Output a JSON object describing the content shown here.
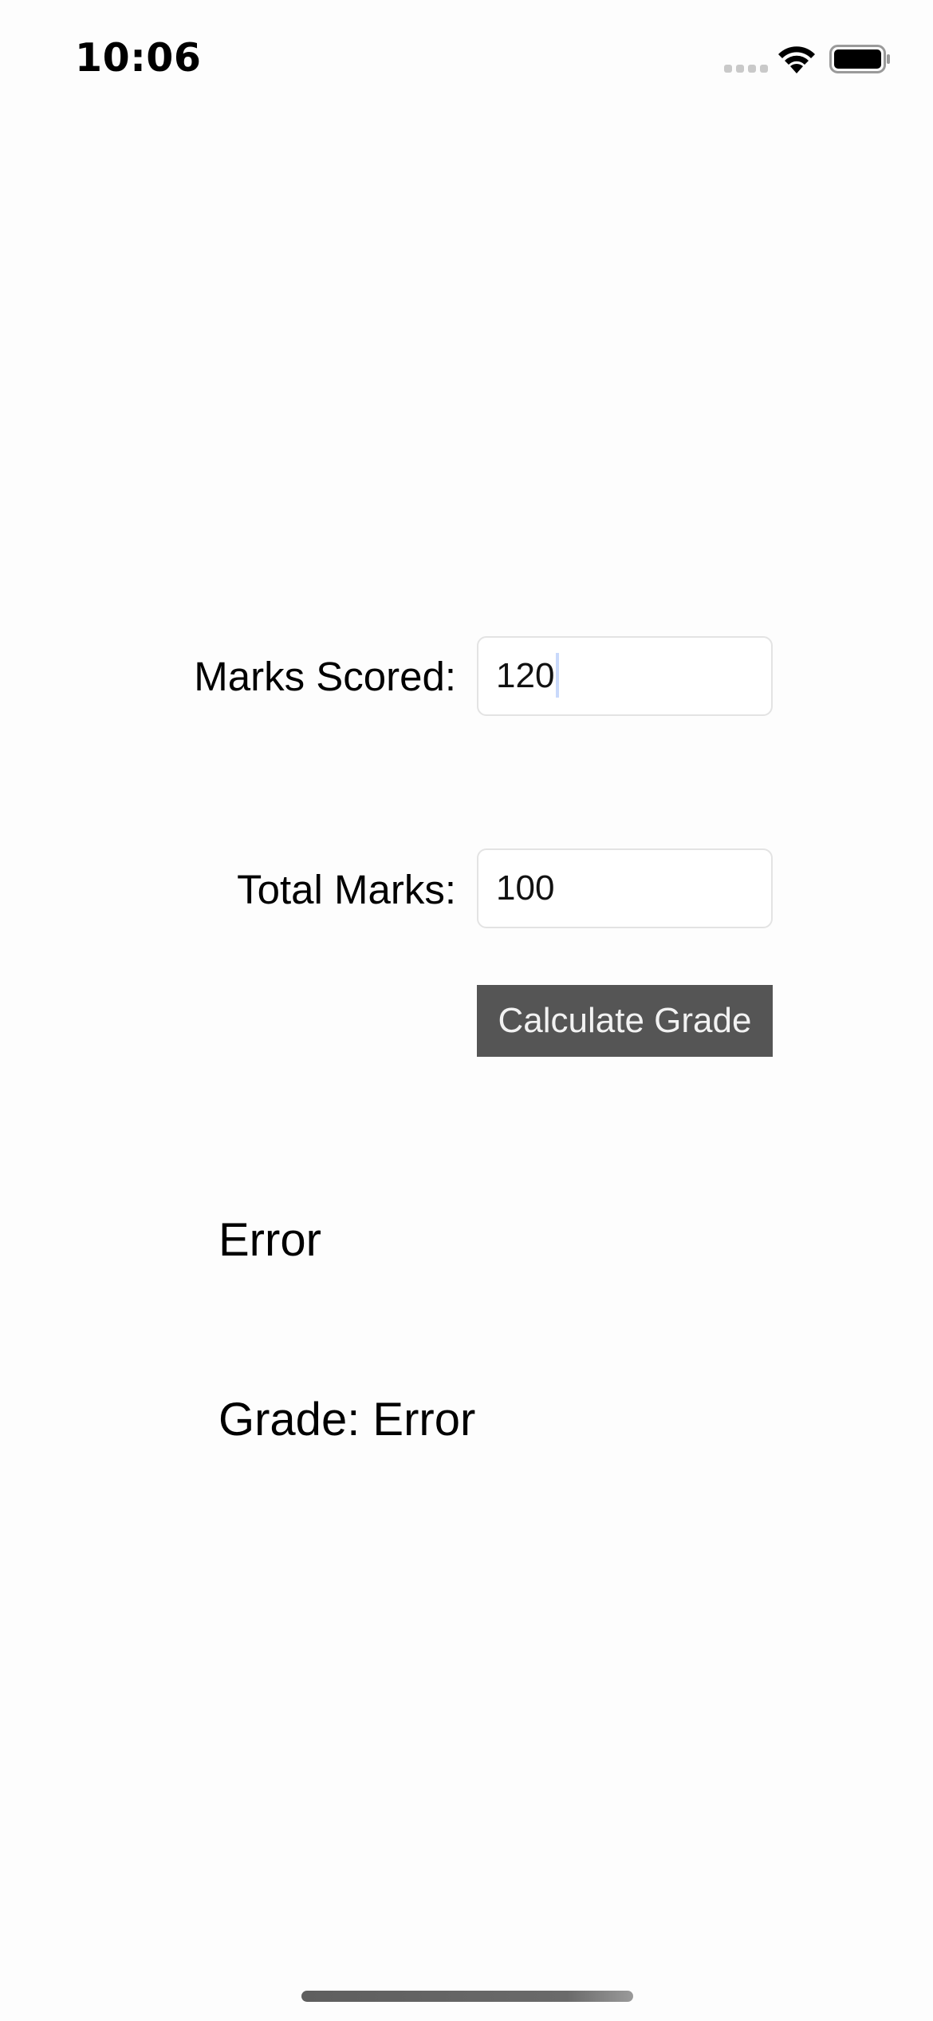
{
  "status_bar": {
    "time": "10:06",
    "icons": [
      "signal-icon",
      "wifi-icon",
      "battery-icon"
    ]
  },
  "form": {
    "marks_scored_label": "Marks Scored:",
    "marks_scored_value": "120",
    "total_marks_label": "Total Marks:",
    "total_marks_value": "100",
    "calculate_button_label": "Calculate Grade"
  },
  "results": {
    "message": "Error",
    "grade": "Grade: Error"
  },
  "colors": {
    "background": "#fdfdfd",
    "button_background": "#555555",
    "button_text": "#f2f2f2",
    "field_border": "#e3e3e3",
    "caret": "#c9d9fb"
  }
}
